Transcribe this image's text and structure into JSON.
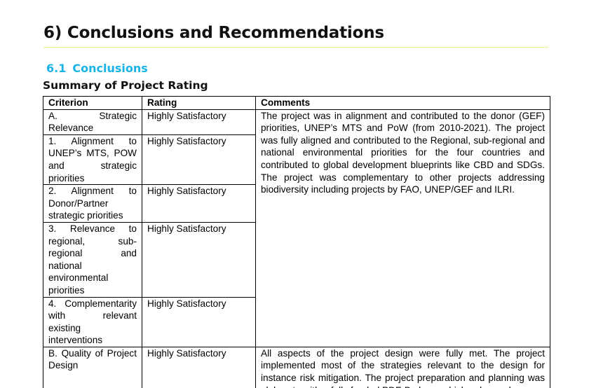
{
  "heading": "6) Conclusions and Recommendations",
  "subheading": {
    "number": "6.1",
    "title": "Conclusions"
  },
  "table_title": "Summary of Project Rating",
  "table": {
    "headers": [
      "Criterion",
      "Rating",
      "Comments"
    ],
    "rows": [
      {
        "criterion": "A. Strategic Relevance",
        "rating": "Highly Satisfactory"
      },
      {
        "criterion": "1. Alignment to UNEP’s MTS, POW and strategic priorities",
        "rating": "Highly Satisfactory"
      },
      {
        "criterion": "2. Alignment to Donor/Partner strategic priorities",
        "rating": "Highly Satisfactory"
      },
      {
        "criterion": "3. Relevance to regional, sub-regional and national environmental priorities",
        "rating": "Highly Satisfactory"
      },
      {
        "criterion": "4. Complementarity with relevant existing interventions",
        "rating": "Highly Satisfactory"
      },
      {
        "criterion": "B. Quality of Project Design",
        "rating": "Highly Satisfactory"
      }
    ],
    "comments": {
      "strategic_relevance": "The project was in alignment and contributed to the donor (GEF) priorities, UNEP’s MTS and PoW (from 2010-2021). The project was fully aligned and contributed to the Regional, sub-regional and national environmental priorities for the four countries and contributed to global development blueprints like CBD and SDGs. The project was complementary to other projects addressing biodiversity including projects by FAO, UNEP/GEF and ILRI.",
      "project_design": "All aspects of the project design were fully met. The project implemented most of the strategies relevant to the design for instance risk mitigation. The project preparation and planning was elaborate with a fully funded PDF-B phase which enhanced"
    }
  }
}
